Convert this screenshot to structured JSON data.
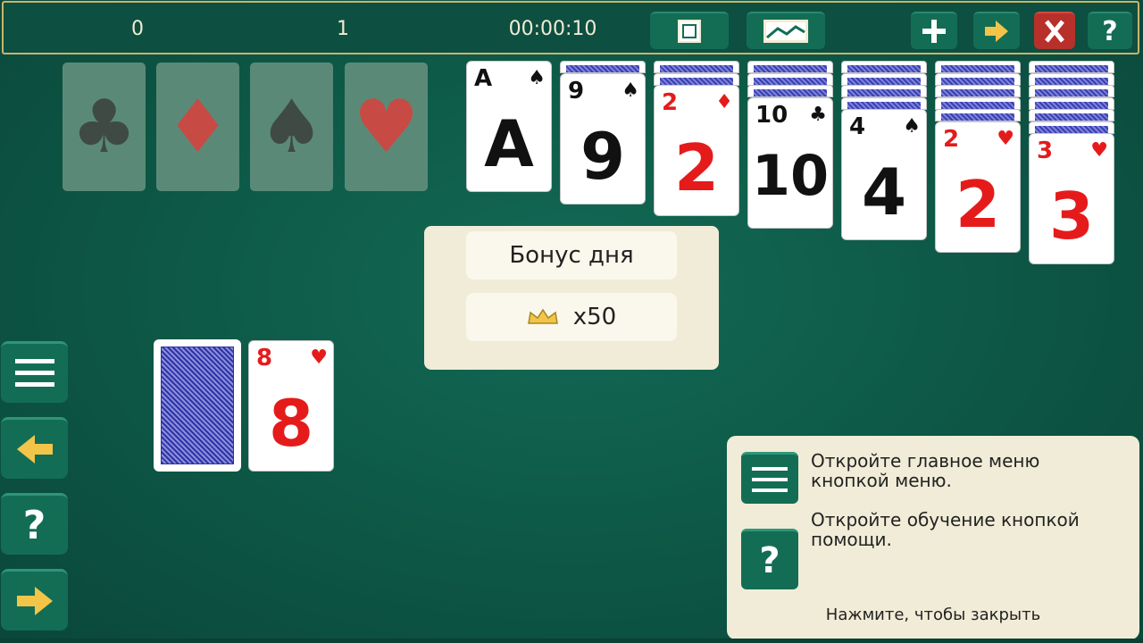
{
  "top_bar": {
    "score": "0",
    "moves": "1",
    "time": "00:00:10",
    "buttons": [
      "fullscreen-icon",
      "landscape-icon",
      "plus-icon",
      "arrow-right-icon",
      "close-icon",
      "help-icon"
    ],
    "help_label": "?"
  },
  "foundations": [
    {
      "suit": "♣",
      "color": "#3f4a44"
    },
    {
      "suit": "♦",
      "color": "#c84a44"
    },
    {
      "suit": "♠",
      "color": "#3f4a44"
    },
    {
      "suit": "♥",
      "color": "#c84a44"
    }
  ],
  "tableau": [
    {
      "hidden": 0,
      "rank": "A",
      "suit": "♠",
      "color": "black"
    },
    {
      "hidden": 1,
      "rank": "9",
      "suit": "♠",
      "color": "black"
    },
    {
      "hidden": 2,
      "rank": "2",
      "suit": "♦",
      "color": "red"
    },
    {
      "hidden": 3,
      "rank": "10",
      "suit": "♣",
      "color": "black"
    },
    {
      "hidden": 4,
      "rank": "4",
      "suit": "♠",
      "color": "black"
    },
    {
      "hidden": 5,
      "rank": "2",
      "suit": "♥",
      "color": "red"
    },
    {
      "hidden": 6,
      "rank": "3",
      "suit": "♥",
      "color": "red"
    }
  ],
  "waste": {
    "rank": "8",
    "suit": "♥",
    "color": "red"
  },
  "bonus": {
    "title": "Бонус дня",
    "value": "x50"
  },
  "side_buttons": [
    "menu-icon",
    "undo-arrow-icon",
    "help-icon",
    "redo-arrow-icon"
  ],
  "side_help_label": "?",
  "hint": {
    "line1": "Откройте главное меню кнопкой меню.",
    "line2": "Откройте обучение кнопкой помощи.",
    "close": "Нажмите, чтобы закрыть",
    "help_label": "?"
  }
}
